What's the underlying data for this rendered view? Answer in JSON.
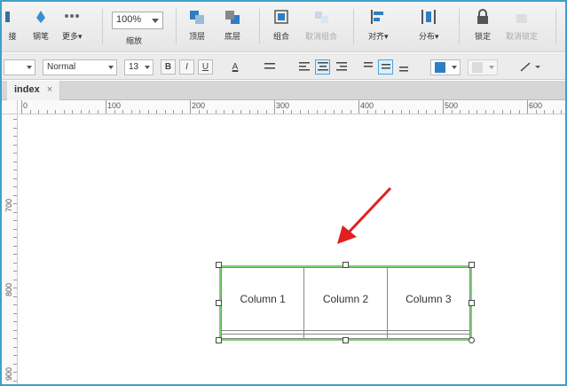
{
  "toolbar": {
    "tools": [
      {
        "label": "接",
        "icon": "connector-icon"
      },
      {
        "label": "钢笔",
        "icon": "pen-icon"
      },
      {
        "label": "更多▾",
        "icon": "more-icon"
      },
      {
        "label": "顶层",
        "icon": "bring-to-front-icon"
      },
      {
        "label": "底层",
        "icon": "send-to-back-icon"
      },
      {
        "label": "组合",
        "icon": "group-icon"
      },
      {
        "label": "取消组合",
        "icon": "ungroup-icon"
      },
      {
        "label": "对齐▾",
        "icon": "align-icon"
      },
      {
        "label": "分布▾",
        "icon": "distribute-icon"
      },
      {
        "label": "锁定",
        "icon": "lock-icon"
      },
      {
        "label": "取消锁定",
        "icon": "unlock-icon"
      }
    ],
    "zoom": {
      "value": "100%",
      "label": "缩放"
    }
  },
  "format_bar": {
    "style": "Normal",
    "font_size": "13",
    "bold": "B",
    "italic": "I",
    "underline": "U",
    "text_color": "A"
  },
  "tabs": [
    {
      "label": "index",
      "close": "×"
    }
  ],
  "ruler": {
    "h_labels": [
      "0",
      "100",
      "200",
      "300",
      "400",
      "500",
      "600"
    ],
    "v_labels": [
      "700",
      "800",
      "900"
    ]
  },
  "table_widget": {
    "headers": [
      "Column 1",
      "Column 2",
      "Column 3"
    ],
    "rows": [
      [
        "",
        "",
        ""
      ],
      [
        "",
        "",
        ""
      ]
    ]
  },
  "colors": {
    "selection": "#7bcf73",
    "arrow": "#e02020",
    "accent": "#4aa3df"
  }
}
